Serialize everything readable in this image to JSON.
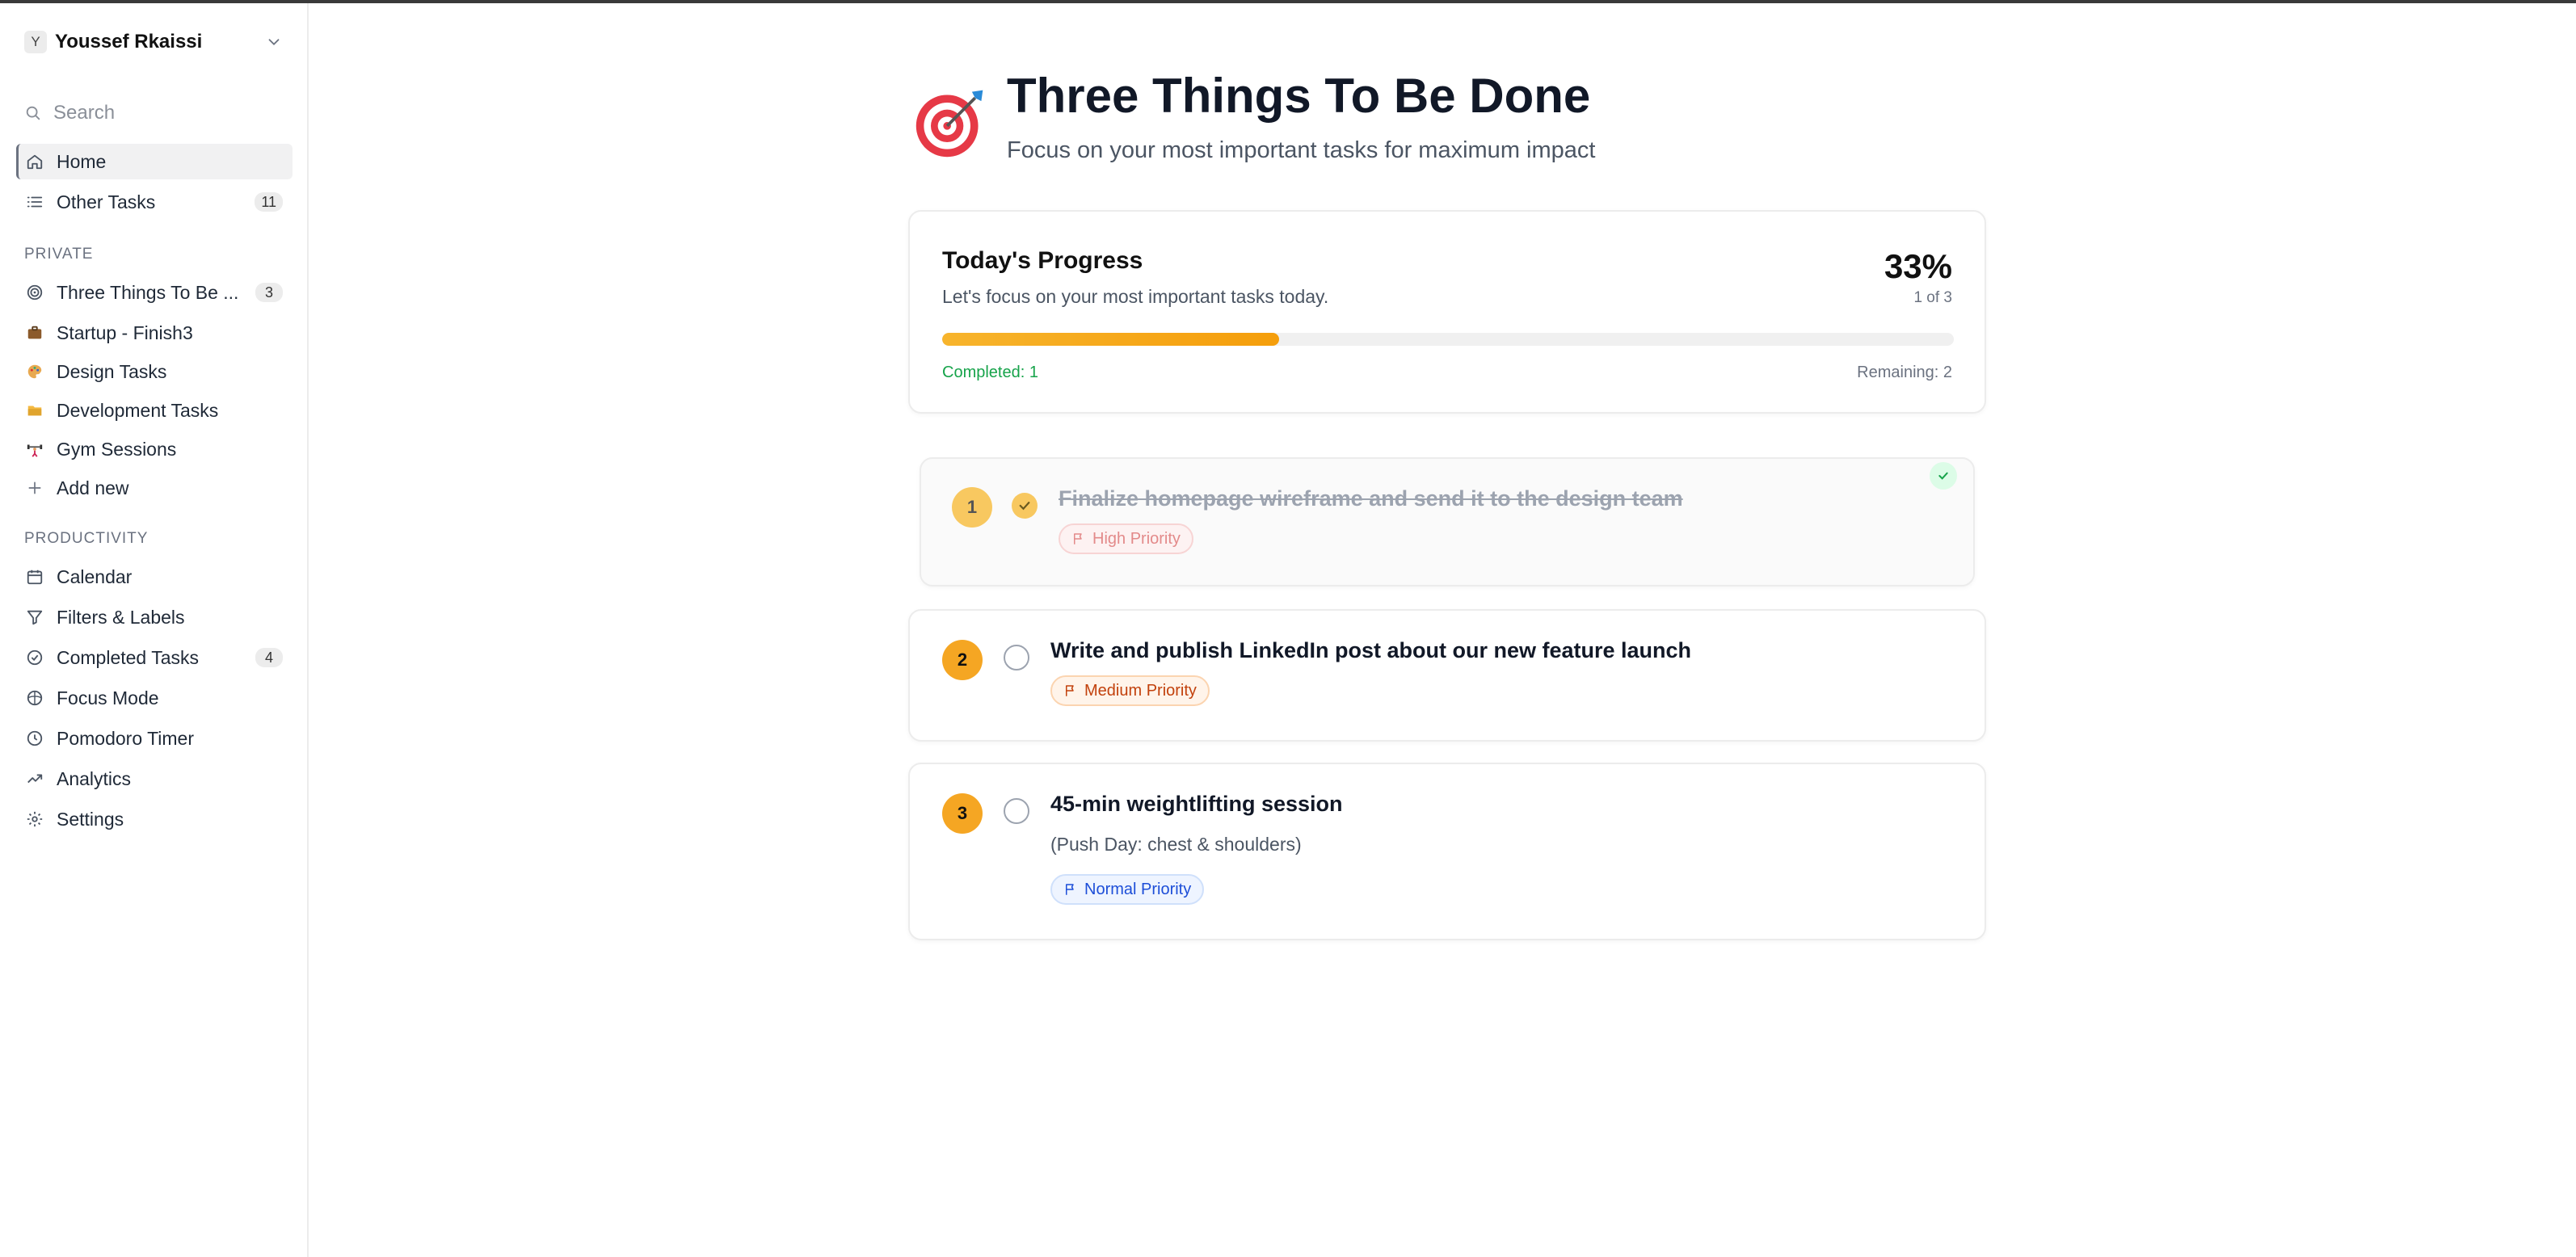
{
  "sidebar": {
    "user": {
      "initial": "Y",
      "name": "Youssef Rkaissi"
    },
    "search_placeholder": "Search",
    "top_items": [
      {
        "label": "Home",
        "icon": "home-icon",
        "active": true
      },
      {
        "label": "Other Tasks",
        "icon": "list-icon",
        "count": "11"
      }
    ],
    "private_label": "PRIVATE",
    "private_items": [
      {
        "label": "Three Things To Be ...",
        "icon": "target-icon",
        "count": "3"
      },
      {
        "label": "Startup - Finish3",
        "icon": "briefcase-icon"
      },
      {
        "label": "Design Tasks",
        "icon": "palette-icon"
      },
      {
        "label": "Development Tasks",
        "icon": "folder-icon"
      },
      {
        "label": "Gym Sessions",
        "icon": "weightlifter-icon"
      },
      {
        "label": "Add new",
        "icon": "plus-icon"
      }
    ],
    "productivity_label": "PRODUCTIVITY",
    "productivity_items": [
      {
        "label": "Calendar",
        "icon": "calendar-icon"
      },
      {
        "label": "Filters & Labels",
        "icon": "filter-icon"
      },
      {
        "label": "Completed Tasks",
        "icon": "check-circle-icon",
        "count": "4"
      },
      {
        "label": "Focus Mode",
        "icon": "focus-icon"
      },
      {
        "label": "Pomodoro Timer",
        "icon": "clock-icon"
      },
      {
        "label": "Analytics",
        "icon": "trending-icon"
      },
      {
        "label": "Settings",
        "icon": "gear-icon"
      }
    ]
  },
  "header": {
    "title": "Three Things To Be Done",
    "subtitle": "Focus on your most important tasks for maximum impact"
  },
  "progress": {
    "title": "Today's Progress",
    "subtitle": "Let's focus on your most important tasks today.",
    "percent": "33%",
    "of_text": "1 of 3",
    "fraction": 0.333,
    "completed_text": "Completed: 1",
    "remaining_text": "Remaining: 2"
  },
  "tasks": [
    {
      "number": "1",
      "title": "Finalize homepage wireframe and send it to the design team",
      "priority": "High Priority",
      "done": true
    },
    {
      "number": "2",
      "title": "Write and publish LinkedIn post about our new feature launch",
      "priority": "Medium Priority",
      "done": false
    },
    {
      "number": "3",
      "title": "45-min weightlifting session",
      "note": "(Push Day: chest & shoulders)",
      "priority": "Normal Priority",
      "done": false
    }
  ],
  "colors": {
    "accent": "#f5a623",
    "completed_green": "#16a34a",
    "high_priority": "#e38a8a",
    "medium_priority": "#c2410c",
    "normal_priority": "#1d4ed8"
  }
}
